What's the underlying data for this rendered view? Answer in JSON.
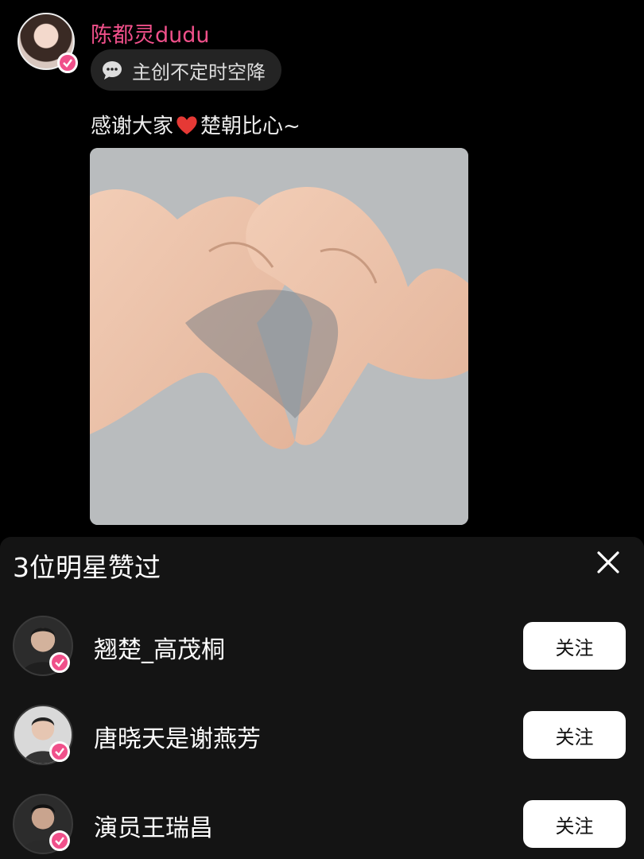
{
  "post": {
    "author": "陈都灵dudu",
    "tag_label": "主创不定时空降",
    "caption_before": "感谢大家",
    "caption_after": "楚朝比心~"
  },
  "likes_sheet": {
    "title": "3位明星赞过",
    "users": [
      {
        "name": "翘楚_高茂桐",
        "follow_label": "关注"
      },
      {
        "name": "唐晓天是谢燕芳",
        "follow_label": "关注"
      },
      {
        "name": "演员王瑞昌",
        "follow_label": "关注"
      }
    ]
  },
  "icons": {
    "tag": "chat-bubble-icon",
    "caption_emoji": "red-heart-icon",
    "close": "close-icon",
    "verified": "verified-badge-icon"
  },
  "colors": {
    "author": "#f0508a",
    "verified_badge": "#f0508a",
    "sheet_background": "#141414",
    "follow_button": "#ffffff"
  }
}
